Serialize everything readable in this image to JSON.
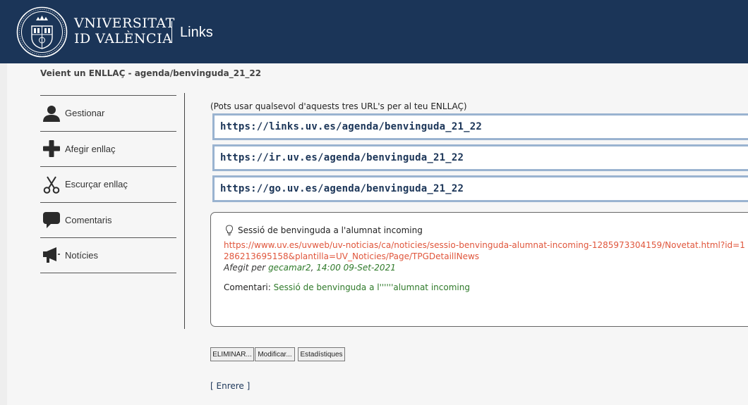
{
  "header": {
    "university_line1": "VNIVERSITAT",
    "university_line2": "ID VALÈNCIA",
    "app_title": "Links",
    "background_color": "#1b3558"
  },
  "page_title": "Veient un ENLLAÇ - agenda/benvinguda_21_22",
  "menu": {
    "items": [
      {
        "label": "Gestionar",
        "icon": "user-icon"
      },
      {
        "label": "Afegir enllaç",
        "icon": "plus-icon"
      },
      {
        "label": "Escurçar enllaç",
        "icon": "scissors-icon"
      },
      {
        "label": "Comentaris",
        "icon": "speech-bubble-icon"
      },
      {
        "label": "Notícies",
        "icon": "megaphone-icon"
      }
    ]
  },
  "links": {
    "hint": "(Pots usar qualsevol d'aquests tres URL's per al teu ENLLAÇ)",
    "urls": [
      "https://links.uv.es/agenda/benvinguda_21_22",
      "https://ir.uv.es/agenda/benvinguda_21_22",
      "https://go.uv.es/agenda/benvinguda_21_22"
    ],
    "border_color": "#9ab3d0"
  },
  "detail": {
    "title": "Sessió de benvinguda a l'alumnat incoming",
    "target_url": "https://www.uv.es/uvweb/uv-noticias/ca/noticies/sessio-benvinguda-alumnat-incoming-1285973304159/Novetat.html?id=1286213695158&plantilla=UV_Noticies/Page/TPGDetaillNews",
    "added_by_prefix": "Afegit per",
    "added_by_user": "gecamar2",
    "added_date": "14:00 09-Set-2021",
    "comment_label": "Comentari:",
    "comment_text": "Sessió de benvinguda a l''''''alumnat incoming",
    "url_color": "#e0563c",
    "green_color": "#2f7a2a"
  },
  "actions": {
    "delete_label": "ELIMINAR...",
    "modify_label": "Modificar...",
    "stats_label": "Estadístiques"
  },
  "back_link": {
    "open": "[",
    "label": "Enrere",
    "close": "]"
  }
}
